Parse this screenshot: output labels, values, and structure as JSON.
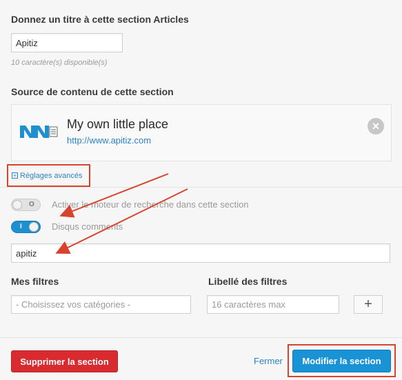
{
  "section_title": {
    "heading": "Donnez un titre à cette section Articles",
    "value": "Apitiz",
    "hint": "10 caractère(s) disponible(s)"
  },
  "source": {
    "heading": "Source de contenu de cette section",
    "title": "My own little place",
    "url": "http://www.apitiz.com",
    "remove_symbol": "×"
  },
  "advanced": {
    "label": "Réglages avancés",
    "plus_symbol": "+"
  },
  "options": {
    "search_toggle": {
      "label": "Activer le moteur de recherche dans cette section",
      "state": "off",
      "mark": "O"
    },
    "disqus_toggle": {
      "label": "Disqus comments",
      "state": "on",
      "mark": "I"
    },
    "disqus_value": "apitiz"
  },
  "filters": {
    "my_filters_heading": "Mes filtres",
    "categories_placeholder": "- Choisissez vos catégories -",
    "labels_heading": "Libellé des filtres",
    "labels_placeholder": "16 caractères max",
    "add_symbol": "+"
  },
  "footer": {
    "delete_label": "Supprimer la section",
    "close_label": "Fermer",
    "modify_label": "Modifier la section"
  },
  "colors": {
    "annotation_red": "#d9432e",
    "primary_blue": "#1a92d6",
    "danger_red": "#d92a30",
    "link_blue": "#2a85c4"
  }
}
